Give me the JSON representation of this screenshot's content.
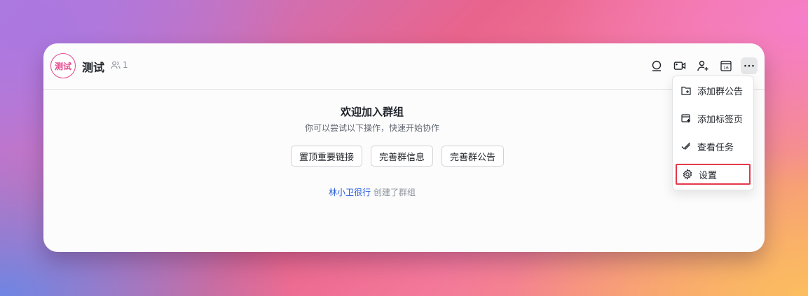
{
  "header": {
    "avatar_text": "测试",
    "title": "测试",
    "member_count": "1",
    "toolbar": [
      "search-icon",
      "video-icon",
      "add-member-icon",
      "calendar-icon",
      "more-icon"
    ],
    "calendar_day": "16"
  },
  "welcome": {
    "title": "欢迎加入群组",
    "subtitle": "你可以尝试以下操作，快速开始协作",
    "actions": [
      "置顶重要链接",
      "完善群信息",
      "完善群公告"
    ]
  },
  "created": {
    "user": "林小卫很行",
    "text": "创建了群组"
  },
  "menu": {
    "items": [
      {
        "label": "添加群公告",
        "icon": "announcement-icon"
      },
      {
        "label": "添加标签页",
        "icon": "add-tab-icon"
      },
      {
        "label": "查看任务",
        "icon": "task-icon"
      },
      {
        "label": "设置",
        "icon": "settings-icon",
        "highlighted": true
      }
    ]
  },
  "colors": {
    "accent_pink": "#e4478e",
    "link_blue": "#245bdb",
    "highlight_red": "#e5384a"
  }
}
